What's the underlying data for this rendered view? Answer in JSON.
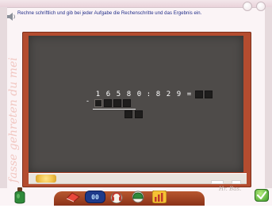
{
  "instruction": "Rechne schriftlich und gib bei jeder Aufgabe die Rechenschritte und das Ergebnis ein.",
  "side_text": "fasse gehreten du mei",
  "problem": {
    "dividend_digits": [
      "1",
      "6",
      "5",
      "8",
      "0"
    ],
    "operator": ":",
    "divisor_digits": [
      "8",
      "2",
      "9"
    ],
    "equals": "=",
    "subtraction_sign": "-"
  },
  "signature": "Hr. Bas.",
  "toolbar": {
    "counter_label": "00",
    "icons": [
      "eraser-icon",
      "counter-icon",
      "headphones-icon",
      "green-cap-icon",
      "bar-chart-icon"
    ]
  },
  "colors": {
    "board": "#4e4b49",
    "frame": "#b44c2f",
    "instruction_text": "#1f2b88",
    "ok_green": "#3d9c2a"
  }
}
